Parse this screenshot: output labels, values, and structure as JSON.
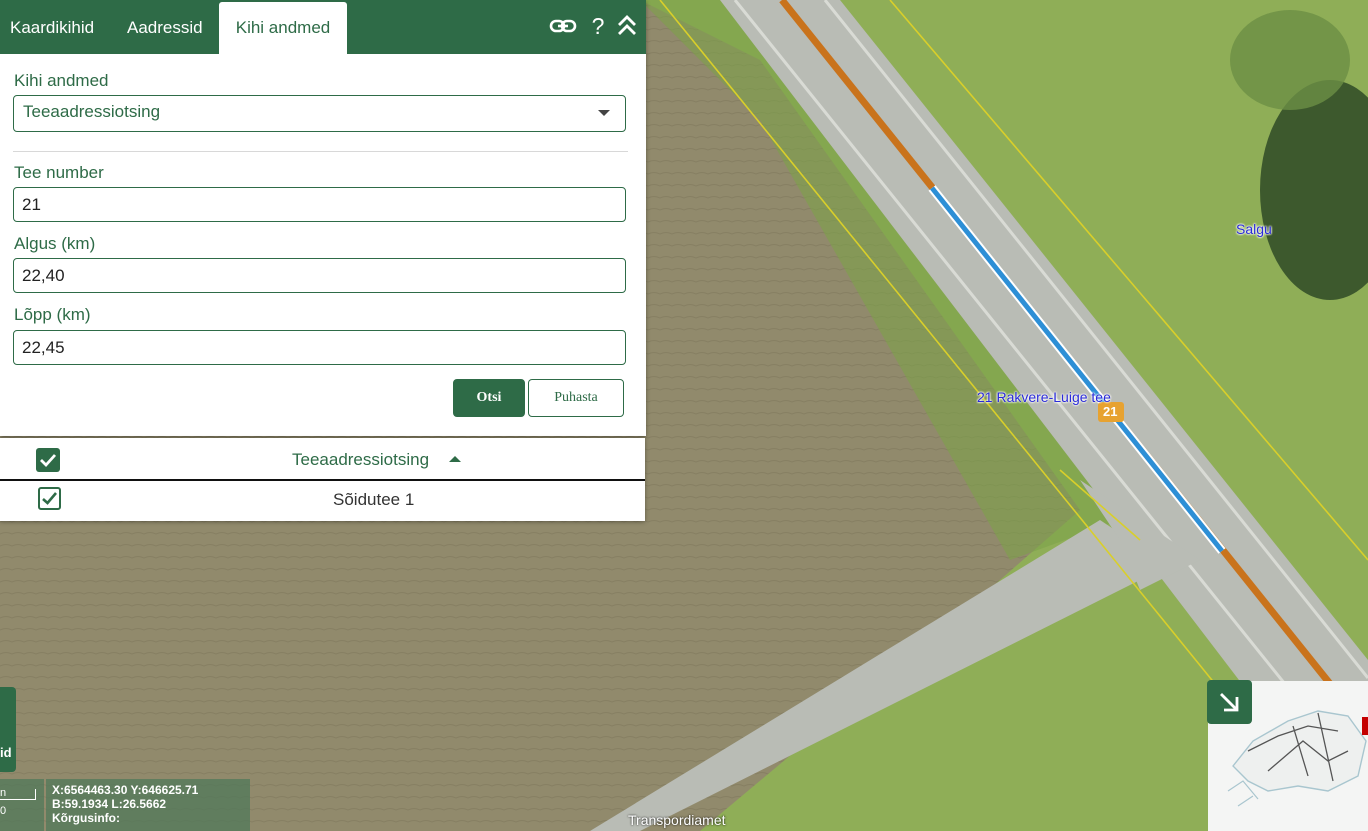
{
  "colors": {
    "brand": "#2e6b47",
    "road_orange": "#c9731c",
    "highlight_blue": "#2d8fd6",
    "boundary_yellow": "#d9cf2a"
  },
  "tabs": [
    {
      "label": "Kaardikihid"
    },
    {
      "label": "Aadressid"
    },
    {
      "label": "Kihi andmed",
      "active": true
    }
  ],
  "toolbar_icons": [
    "link-icon",
    "help-icon",
    "collapse-up-icon"
  ],
  "toolbar": {
    "help_glyph": "?"
  },
  "form": {
    "layer_label": "Kihi andmed",
    "layer_value": "Teeaadressiotsing",
    "road_label": "Tee number",
    "road_value": "21",
    "start_label": "Algus (km)",
    "start_value": "22,40",
    "end_label": "Lõpp (km)",
    "end_value": "22,45",
    "search_button": "Otsi",
    "clear_button": "Puhasta"
  },
  "results": {
    "title": "Teeaadressiotsing",
    "header_checked": true,
    "rows": [
      {
        "label": "Sõidutee 1",
        "checked": true
      }
    ]
  },
  "map": {
    "labels": {
      "village": "Salgu",
      "road": "21 Rakvere-Luige tee",
      "road_marker": "21"
    },
    "coordinates": {
      "xy": "X:6564463.30 Y:646625.71",
      "bl": "B:59.1934 L:26.5662",
      "height": "Kõrgusinfo:"
    },
    "scale_fragment": "n",
    "scale_fragment2": "0",
    "side_button_fragment": "id",
    "credit": "Transpordiamet"
  }
}
